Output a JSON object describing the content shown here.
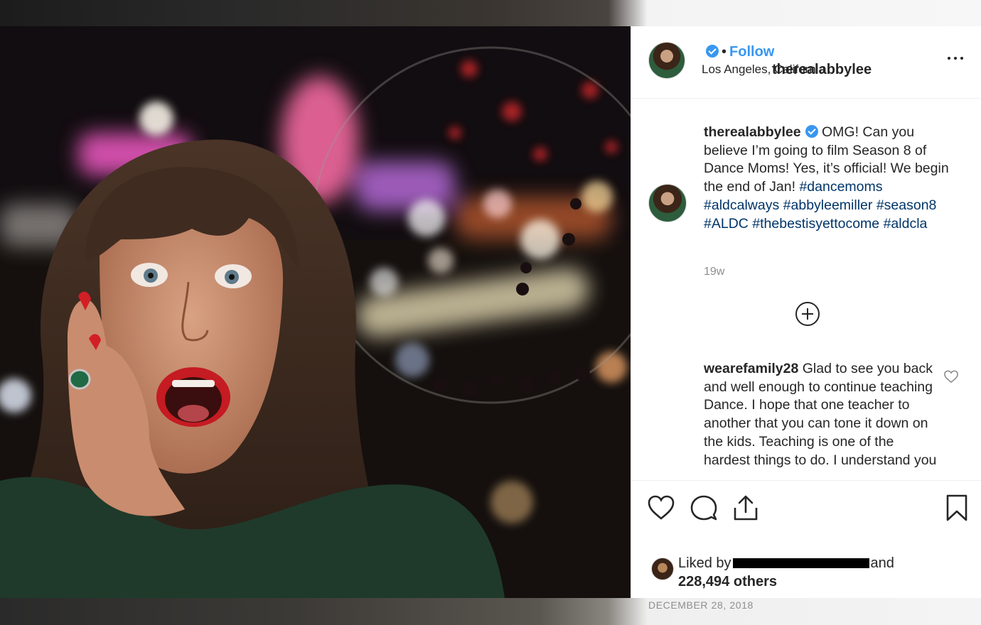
{
  "post": {
    "username": "therealabbylee",
    "follow_label": "Follow",
    "separator": "•",
    "location": "Los Angeles, California"
  },
  "caption": {
    "username": "therealabbylee",
    "text": "OMG! Can you believe I’m going to film Season 8 of Dance Moms! Yes, it’s official! We begin the end of Jan!",
    "hashtags": [
      "#dancemoms",
      "#aldcalways",
      "#abbyleemiller",
      "#season8",
      "#ALDC",
      "#thebestisyettocome",
      "#aldcla"
    ],
    "time_ago": "19w"
  },
  "comments": [
    {
      "username": "wearefamily28",
      "text": "Glad to see you back and well enough to continue teaching Dance. I hope that one teacher to another that you can tone it down on the kids. Teaching is one of the hardest things to do. I understand you"
    }
  ],
  "likes": {
    "prefix": "Liked by",
    "suffix": "and",
    "count_text": "228,494 others"
  },
  "date": "DECEMBER 28, 2018",
  "icons": [
    "verified-badge-icon",
    "more-options-icon",
    "load-more-comments-icon",
    "comment-heart-icon",
    "heart-icon",
    "comment-icon",
    "share-icon",
    "bookmark-icon"
  ],
  "colors": {
    "link_blue": "#3897f0",
    "hashtag": "#003569",
    "muted": "#8e8e8e",
    "text": "#262626"
  }
}
